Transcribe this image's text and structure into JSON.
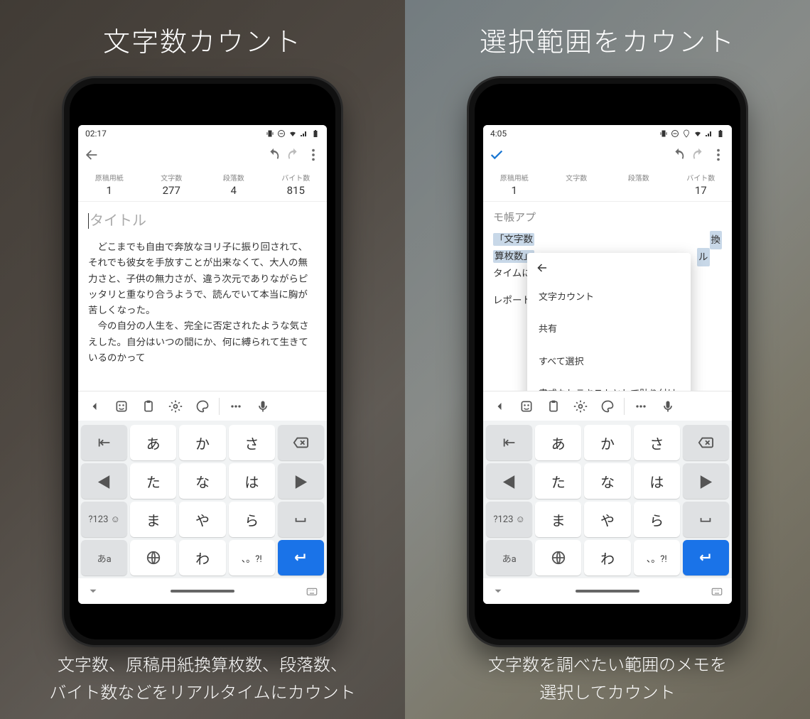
{
  "left": {
    "headline": "文字数カウント",
    "subline": "文字数、原稿用紙換算枚数、段落数、\nバイト数などをリアルタイムにカウント",
    "status_time": "02:17",
    "toolbar": {
      "back": "←",
      "undo": "↶",
      "redo": "↷",
      "more": "⋮"
    },
    "stats": [
      {
        "label": "原稿用紙",
        "value": "1"
      },
      {
        "label": "文字数",
        "value": "277"
      },
      {
        "label": "段落数",
        "value": "4"
      },
      {
        "label": "バイト数",
        "value": "815"
      }
    ],
    "title_placeholder": "タイトル",
    "body_paragraphs": [
      "どこまでも自由で奔放なヨリ子に振り回されて、それでも彼女を手放すことが出来なくて、大人の無力さと、子供の無力さが、違う次元でありながらピッタリと重なり合うようで、読んでいて本当に胸が苦しくなった。",
      "今の自分の人生を、完全に否定されたような気さえした。自分はいつの間にか、何に縛られて生きているのかって"
    ]
  },
  "right": {
    "headline": "選択範囲をカウント",
    "subline": "文字数を調べたい範囲のメモを\n選択してカウント",
    "status_time": "4:05",
    "toolbar": {
      "confirm": "✓",
      "undo": "↶",
      "redo": "↷",
      "more": "⋮"
    },
    "stats": [
      {
        "label": "原稿用紙",
        "value": "1"
      },
      {
        "label": "文字数",
        "value": ""
      },
      {
        "label": "段落数",
        "value": ""
      },
      {
        "label": "バイト数",
        "value": "17"
      }
    ],
    "title_text": "モ帳アプ",
    "selected_lines": [
      "「文字数",
      "換",
      "算枚数」",
      "ル"
    ],
    "after_sel_line": "タイムに",
    "body_rest": "レポートや原稿の下書き用紙枚数に便利です。",
    "context_menu": {
      "items": [
        "文字カウント",
        "共有",
        "すべて選択",
        "書式なしテキストとして貼り付け"
      ]
    }
  },
  "keyboard": {
    "suggest_icons": [
      "chevron",
      "sticker",
      "clipboard",
      "settings",
      "palette",
      "dots",
      "mic"
    ],
    "rows": [
      [
        {
          "t": "↤",
          "g": true
        },
        {
          "t": "あ"
        },
        {
          "t": "か"
        },
        {
          "t": "さ"
        },
        {
          "t": "⌫",
          "g": true
        }
      ],
      [
        {
          "t": "◀",
          "g": true
        },
        {
          "t": "た"
        },
        {
          "t": "な"
        },
        {
          "t": "は"
        },
        {
          "t": "▶",
          "g": true
        }
      ],
      [
        {
          "t": "?123 ☺",
          "g": true,
          "s": true
        },
        {
          "t": "ま"
        },
        {
          "t": "や"
        },
        {
          "t": "ら"
        },
        {
          "t": "␣",
          "g": true
        }
      ],
      [
        {
          "t": "あa",
          "g": true,
          "s": true
        },
        {
          "t": "⊕",
          "globe": true
        },
        {
          "t": "わ"
        },
        {
          "t": "、。?!",
          "s": true
        },
        {
          "t": "↵",
          "accent": true
        }
      ]
    ]
  }
}
